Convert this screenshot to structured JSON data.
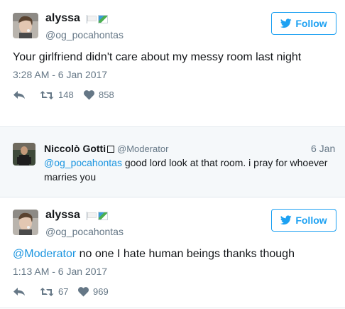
{
  "tweet1": {
    "name": "alyssa",
    "handle": "@og_pocahontas",
    "follow_label": "Follow",
    "text": "Your girlfriend didn't care about my messy room last night",
    "timestamp": "3:28 AM - 6 Jan 2017",
    "retweets": "148",
    "likes": "858"
  },
  "reply": {
    "name": "Niccolò Gotti",
    "handle": "@Moderator",
    "date": "6 Jan",
    "mention": "@og_pocahontas",
    "text_line1": " good lord look at that room. i pray for whoever",
    "text_line2": "marries you"
  },
  "tweet2": {
    "name": "alyssa",
    "handle": "@og_pocahontas",
    "follow_label": "Follow",
    "mention": "@Moderator",
    "text": " no one I hate human beings thanks though",
    "timestamp": "1:13 AM - 6 Jan 2017",
    "retweets": "67",
    "likes": "969"
  },
  "colors": {
    "accent": "#1da1f2",
    "mention": "#1b95e0",
    "muted": "#657786",
    "reply_bg": "#f5f8fa"
  },
  "icons": [
    "bird-icon",
    "reply-icon",
    "retweet-icon",
    "heart-icon",
    "white-flag-icon",
    "rainbow-flag-icon"
  ]
}
